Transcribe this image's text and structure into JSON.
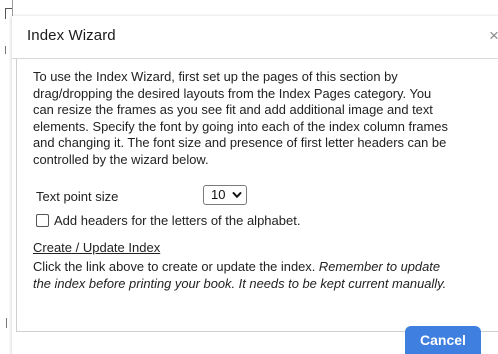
{
  "dialog": {
    "title": "Index Wizard",
    "close_glyph": "×",
    "close_icon": "close-icon"
  },
  "intro": {
    "lines": [
      "To use the Index Wizard, first set up the pages of this section by",
      "drag/dropping the desired layouts from the Index Pages category. You",
      "can resize the frames as you see fit and add additional image and text",
      "elements. Specify the font by going into each of the index column frames",
      "and changing it. The font size and presence of first letter headers can be",
      "controlled by the wizard below."
    ]
  },
  "text_size": {
    "label": "Text point size",
    "selected": "10",
    "icon": "chevron-down-icon"
  },
  "headers_option": {
    "label": "Add headers for the letters of the alphabet.",
    "checked": false
  },
  "create_link": {
    "label": "Create / Update Index"
  },
  "help": {
    "line1_plain": "Click the link above to create or update the index. ",
    "line1_italic": "Remember to update",
    "line2_italic": "the index before printing your book. It needs to be kept current manually."
  },
  "buttons": {
    "cancel": "Cancel"
  },
  "colors": {
    "accent": "#3f7fe0",
    "text": "#222222",
    "border": "#cfcfcf"
  }
}
